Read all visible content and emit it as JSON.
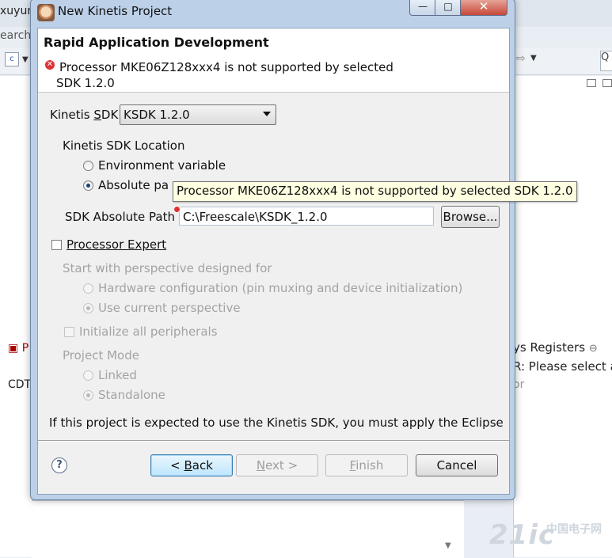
{
  "background": {
    "title_fragment": "xuyun",
    "search_fragment": "earch",
    "cdt_fragment": "CDT",
    "registers_tab": "ys Registers",
    "registers_close": "⊖",
    "registers_text": "R: Please select a",
    "faded_fragment": "or",
    "left_tab_fragment": "P",
    "watermark": "21ic",
    "watermark_sub": "中国电子网"
  },
  "window": {
    "title": "New Kinetis Project",
    "minimize": "—",
    "maximize": "□",
    "close": "✕"
  },
  "header": {
    "title": "Rapid Application Development",
    "error_message_line1": "Processor MKE06Z128xxx4 is not supported by selected",
    "error_message_line2": "SDK 1.2.0"
  },
  "sdk": {
    "label_pre": "Kinetis ",
    "label_mnemonic": "S",
    "label_post": "DK",
    "selected": "KSDK 1.2.0"
  },
  "location": {
    "group_label": "Kinetis SDK Location",
    "env_label": "Environment variable",
    "abs_label": "Absolute pa",
    "path_label": "SDK Absolute Path",
    "path_value": "C:\\Freescale\\KSDK_1.2.0",
    "browse": "Browse..."
  },
  "tooltip": "Processor MKE06Z128xxx4 is not supported by selected SDK 1.2.0",
  "pex": {
    "label": "Processor Expert",
    "perspective_label": "Start with perspective designed for",
    "hw_config": "Hardware configuration (pin muxing and device initialization)",
    "current_perspective": "Use current perspective",
    "init_peripherals": "Initialize all peripherals",
    "project_mode": "Project Mode",
    "linked": "Linked",
    "standalone": "Standalone"
  },
  "footer_note": "If this project is expected to use the Kinetis SDK, you must apply the Eclipse",
  "buttons": {
    "help": "?",
    "back_pre": "< ",
    "back_mnemonic": "B",
    "back_post": "ack",
    "next_mnemonic": "N",
    "next_post": "ext >",
    "finish_mnemonic": "F",
    "finish_post": "inish",
    "cancel": "Cancel"
  }
}
